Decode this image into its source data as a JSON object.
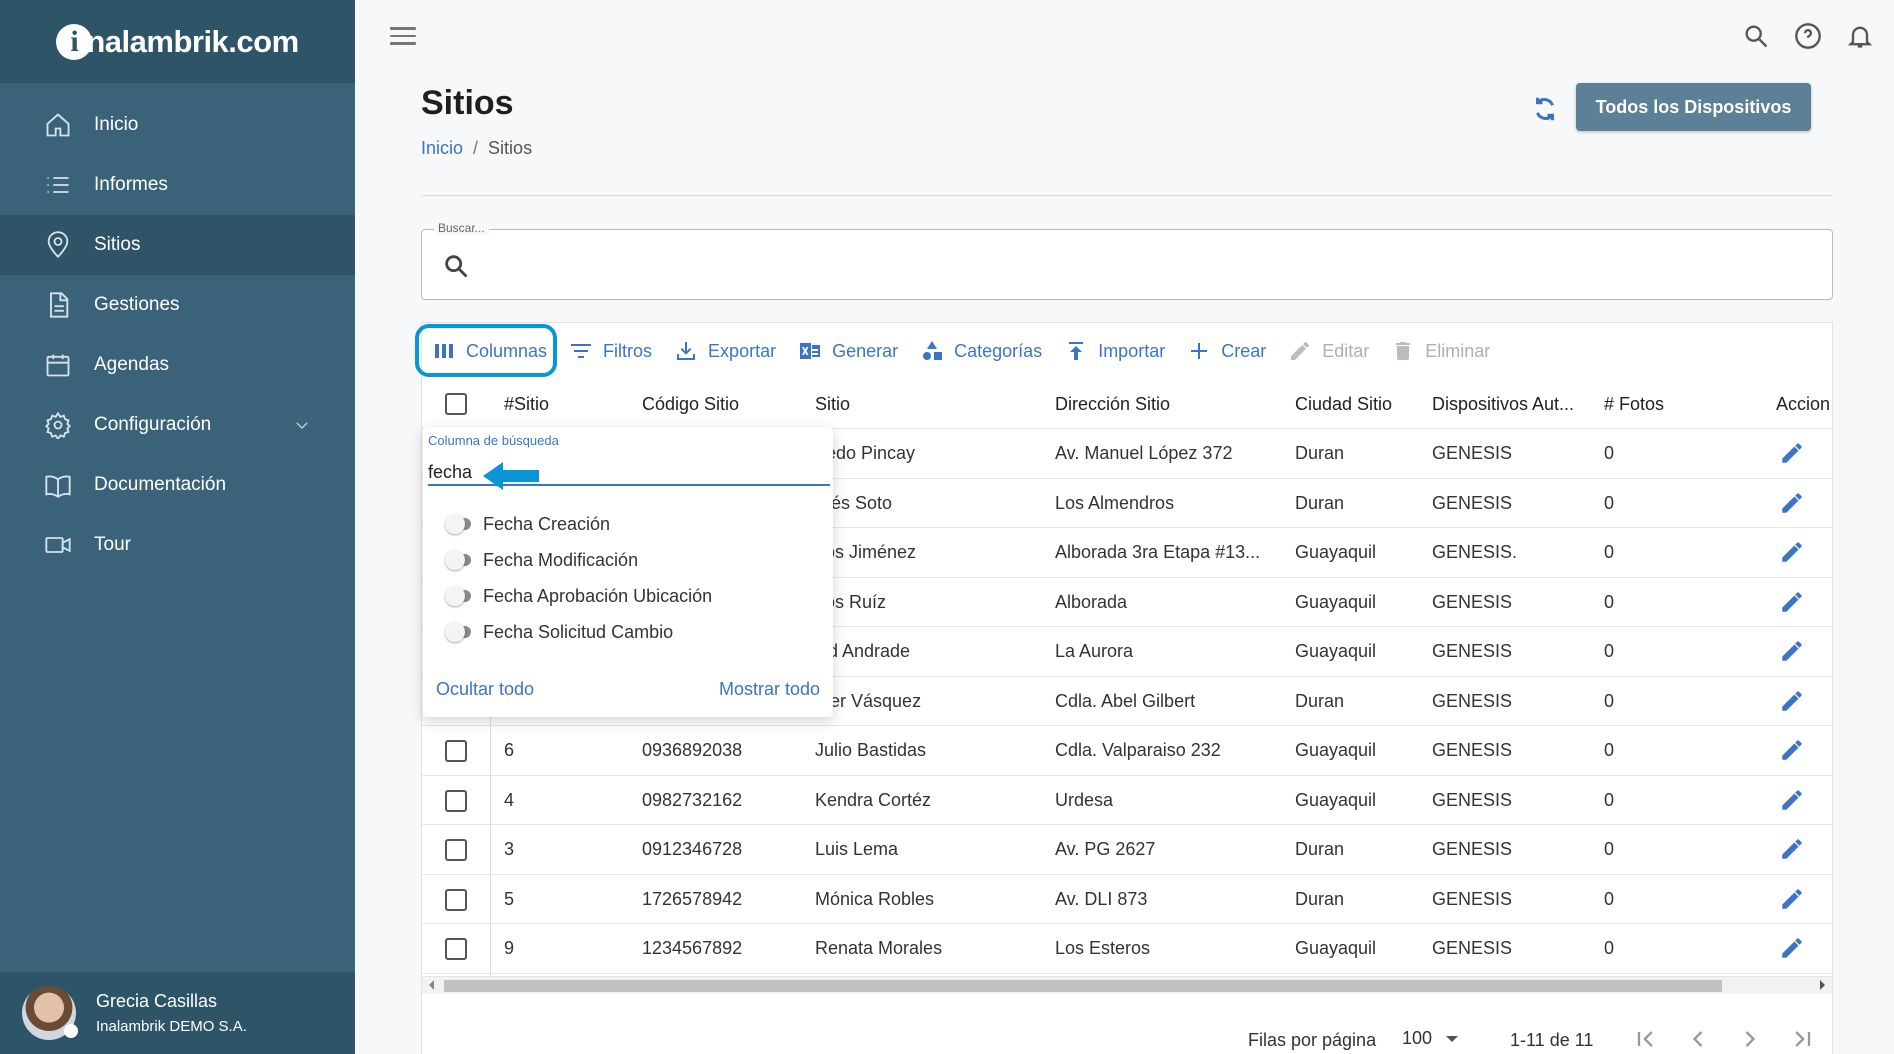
{
  "brand": {
    "logo_letter": "i",
    "logo_text": "nalambrik.com"
  },
  "sidebar": {
    "items": [
      {
        "label": "Inicio",
        "icon": "home-icon"
      },
      {
        "label": "Informes",
        "icon": "list-icon"
      },
      {
        "label": "Sitios",
        "icon": "location-pin-icon",
        "active": true
      },
      {
        "label": "Gestiones",
        "icon": "document-icon"
      },
      {
        "label": "Agendas",
        "icon": "calendar-icon"
      },
      {
        "label": "Configuración",
        "icon": "gear-icon"
      },
      {
        "label": "Documentación",
        "icon": "book-icon"
      },
      {
        "label": "Tour",
        "icon": "video-icon"
      }
    ]
  },
  "user": {
    "name": "Grecia Casillas",
    "org": "Inalambrik DEMO S.A."
  },
  "header": {
    "title": "Sitios",
    "breadcrumb_home": "Inicio",
    "breadcrumb_sep": "/",
    "breadcrumb_current": "Sitios",
    "all_devices_label": "Todos los Dispositivos"
  },
  "search": {
    "legend": "Buscar..."
  },
  "toolbar": {
    "columns": "Columnas",
    "filters": "Filtros",
    "export": "Exportar",
    "generate": "Generar",
    "categories": "Categorías",
    "import": "Importar",
    "create": "Crear",
    "edit": "Editar",
    "delete": "Eliminar"
  },
  "table": {
    "headers": [
      "#Sitio",
      "Código Sitio",
      "Sitio",
      "Dirección Sitio",
      "Ciudad Sitio",
      "Dispositivos Aut...",
      "# Fotos",
      "Accion"
    ],
    "rows": [
      {
        "id": "",
        "code": "",
        "site": "fredo Pincay",
        "address": "Av. Manuel López 372",
        "city": "Duran",
        "devices": "GENESIS",
        "photos": "0"
      },
      {
        "id": "",
        "code": "",
        "site": "drés Soto",
        "address": "Los Almendros",
        "city": "Duran",
        "devices": "GENESIS",
        "photos": "0"
      },
      {
        "id": "",
        "code": "",
        "site": "rlos Jiménez",
        "address": "Alborada 3ra Etapa #13...",
        "city": "Guayaquil",
        "devices": "GENESIS.",
        "photos": "0"
      },
      {
        "id": "",
        "code": "",
        "site": "rlos Ruíz",
        "address": "Alborada",
        "city": "Guayaquil",
        "devices": "GENESIS",
        "photos": "0"
      },
      {
        "id": "",
        "code": "",
        "site": "vid Andrade",
        "address": "La Aurora",
        "city": "Guayaquil",
        "devices": "GENESIS",
        "photos": "0"
      },
      {
        "id": "",
        "code": "",
        "site": "ther Vásquez",
        "address": "Cdla. Abel Gilbert",
        "city": "Duran",
        "devices": "GENESIS",
        "photos": "0"
      },
      {
        "id": "6",
        "code": "0936892038",
        "site": "Julio Bastidas",
        "address": "Cdla. Valparaiso 232",
        "city": "Guayaquil",
        "devices": "GENESIS",
        "photos": "0"
      },
      {
        "id": "4",
        "code": "0982732162",
        "site": "Kendra Cortéz",
        "address": "Urdesa",
        "city": "Guayaquil",
        "devices": "GENESIS",
        "photos": "0"
      },
      {
        "id": "3",
        "code": "0912346728",
        "site": "Luis Lema",
        "address": "Av. PG 2627",
        "city": "Duran",
        "devices": "GENESIS",
        "photos": "0"
      },
      {
        "id": "5",
        "code": "1726578942",
        "site": "Mónica Robles",
        "address": "Av. DLI 873",
        "city": "Duran",
        "devices": "GENESIS",
        "photos": "0"
      },
      {
        "id": "9",
        "code": "1234567892",
        "site": "Renata Morales",
        "address": "Los Esteros",
        "city": "Guayaquil",
        "devices": "GENESIS",
        "photos": "0"
      }
    ]
  },
  "footer": {
    "rows_per_page_label": "Filas por página",
    "rows_per_page": "100",
    "range": "1-11 de 11"
  },
  "columns_panel": {
    "label": "Columna de búsqueda",
    "query": "fecha",
    "options": [
      "Fecha Creación",
      "Fecha Modificación",
      "Fecha Aprobación Ubicación",
      "Fecha Solicitud Cambio"
    ],
    "hide_all": "Ocultar todo",
    "show_all": "Mostrar todo"
  },
  "colors": {
    "accent": "#3b74c7",
    "sidebar": "#3a6379",
    "sidebar_dark": "#2e5468",
    "highlight": "#0a95d8"
  }
}
